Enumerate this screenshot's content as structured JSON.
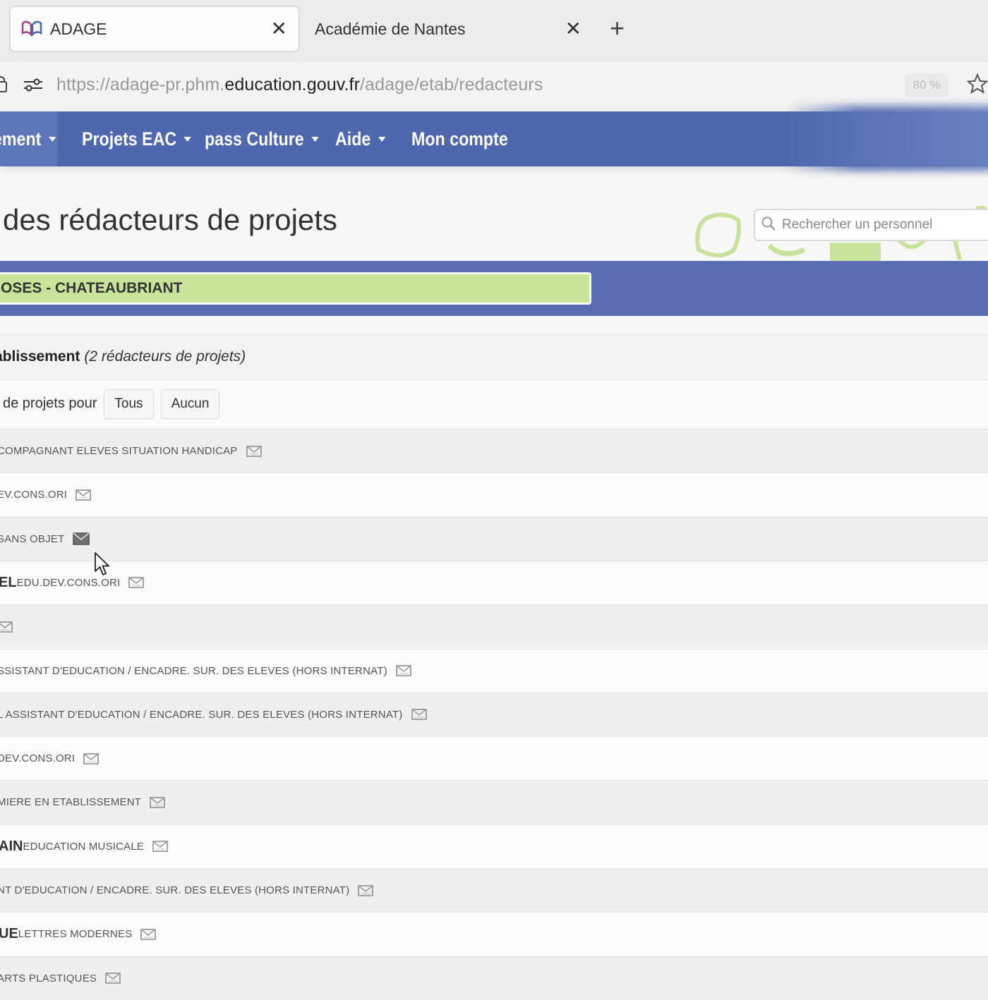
{
  "browser": {
    "tabs": [
      {
        "title": "ADAGE",
        "active": true
      },
      {
        "title": "Académie de Nantes",
        "active": false
      }
    ],
    "url_prefix": "https://adage-pr.phm.",
    "url_domain": "education.gouv.fr",
    "url_path": "/adage/etab/redacteurs",
    "zoom": "80 %",
    "icons": [
      "lock-icon",
      "tune-icon",
      "close-icon",
      "plus-icon",
      "star-icon"
    ]
  },
  "nav": {
    "items": [
      "ement",
      "Projets EAC",
      "pass Culture",
      "Aide",
      "Mon compte"
    ],
    "color": "#4e67ae"
  },
  "page": {
    "title": "des rédacteurs de projets",
    "search_placeholder": "Rechercher un personnel"
  },
  "establishment": {
    "label": "OSES - CHATEAUBRIANT",
    "field_color": "#c8e39a"
  },
  "summary": {
    "bold": "ablissement",
    "italic": "(2 rédacteurs de projets)"
  },
  "selection": {
    "label": "de projets pour",
    "all_button": "Tous",
    "none_button": "Aucun"
  },
  "staff_rows": [
    {
      "name": "",
      "role": "COMPAGNANT ELEVES SITUATION HANDICAP"
    },
    {
      "name": "",
      "role": "EV.CONS.ORI"
    },
    {
      "name": "",
      "role": "SANS OBJET"
    },
    {
      "name": "EL",
      "role": "EDU.DEV.CONS.ORI"
    },
    {
      "name": "",
      "role": ""
    },
    {
      "name": "",
      "role": "SSISTANT D'EDUCATION / ENCADRE. SUR. DES ELEVES (HORS INTERNAT)"
    },
    {
      "name": "",
      "role": "L ASSISTANT D'EDUCATION / ENCADRE. SUR. DES ELEVES (HORS INTERNAT)"
    },
    {
      "name": "",
      "role": "DEV.CONS.ORI"
    },
    {
      "name": "",
      "role": "MIERE EN ETABLISSEMENT"
    },
    {
      "name": "AIN",
      "role": "EDUCATION MUSICALE"
    },
    {
      "name": "",
      "role": "NT D'EDUCATION / ENCADRE. SUR. DES ELEVES (HORS INTERNAT)"
    },
    {
      "name": "UE",
      "role": "LETTRES MODERNES"
    },
    {
      "name": "",
      "role": "ARTS PLASTIQUES"
    }
  ]
}
